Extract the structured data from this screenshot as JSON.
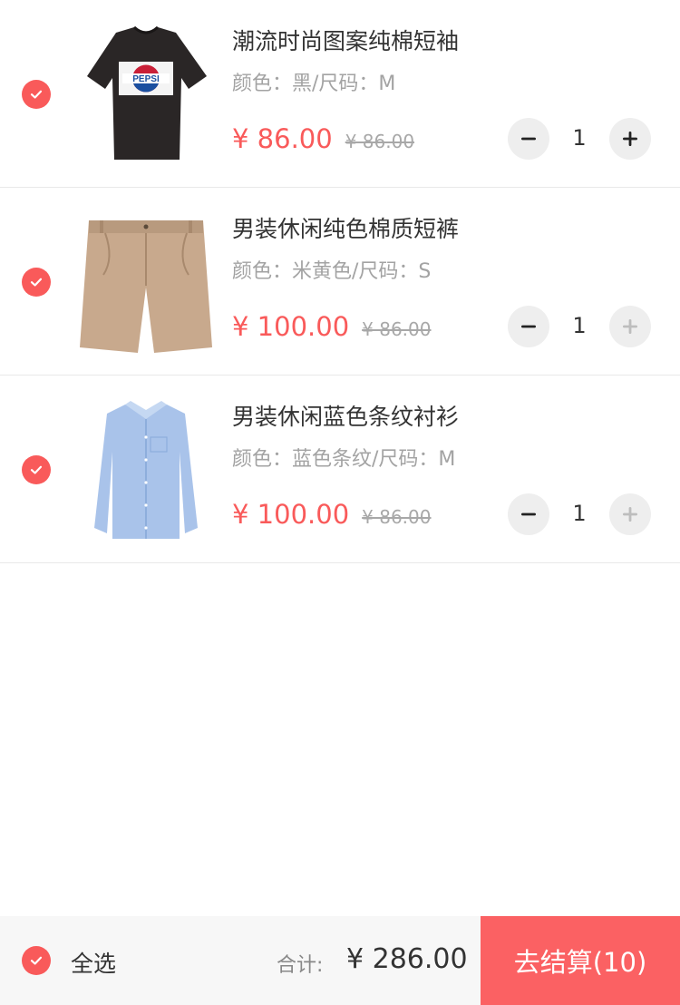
{
  "cart": {
    "items": [
      {
        "title": "潮流时尚图案纯棉短袖",
        "spec": "颜色：黑/尺码：M",
        "price": "¥ 86.00",
        "original_price": "¥ 86.00",
        "quantity": "1",
        "image": "black-pepsi-tshirt",
        "logo_text": "PEPSI",
        "selected": true,
        "plus_enabled": true
      },
      {
        "title": "男装休闲纯色棉质短裤",
        "spec": "颜色：米黄色/尺码：S",
        "price": "¥ 100.00",
        "original_price": "¥ 86.00",
        "quantity": "1",
        "image": "beige-chino-shorts",
        "selected": true,
        "plus_enabled": false
      },
      {
        "title": "男装休闲蓝色条纹衬衫",
        "spec": "颜色：蓝色条纹/尺码：M",
        "price": "¥ 100.00",
        "original_price": "¥ 86.00",
        "quantity": "1",
        "image": "blue-striped-shirt",
        "selected": true,
        "plus_enabled": false
      }
    ]
  },
  "footer": {
    "select_all_label": "全选",
    "select_all_checked": true,
    "total_label": "合计:",
    "total_value": "¥ 286.00",
    "checkout_label": "去结算(10)"
  },
  "colors": {
    "accent": "#f95a5a",
    "checkout_bg": "#fb6163",
    "muted_text": "#a3a3a3",
    "stepper_bg": "#eeeeee"
  },
  "icons": {
    "check": "checkmark-icon",
    "minus": "minus-icon",
    "plus": "plus-icon"
  }
}
